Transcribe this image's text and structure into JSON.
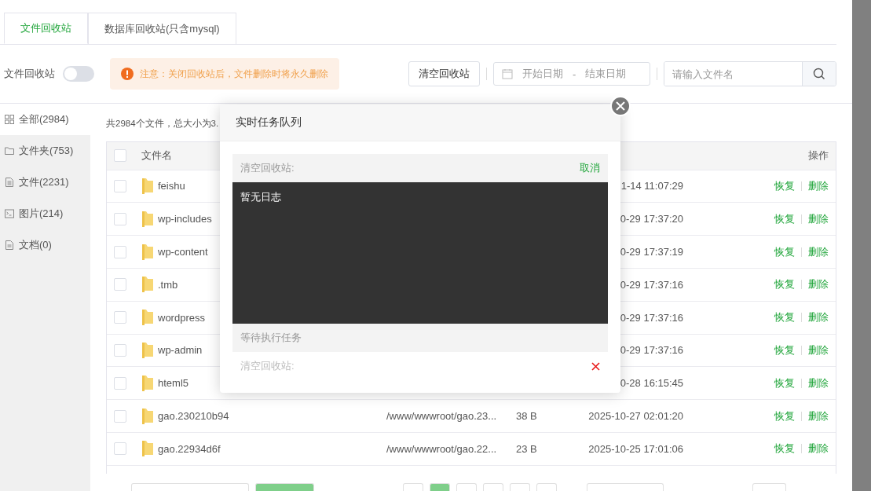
{
  "tabs": [
    {
      "label": "文件回收站",
      "selected": true
    },
    {
      "label": "数据库回收站(只含mysql)",
      "selected": false
    }
  ],
  "recycle_toggle": {
    "label": "文件回收站",
    "on": false
  },
  "notice": {
    "text": "注意：关闭回收站后，文件删除时将永久删除"
  },
  "toolbar": {
    "clear_button": "清空回收站",
    "date_range": {
      "start_placeholder": "开始日期",
      "separator": "-",
      "end_placeholder": "结束日期"
    },
    "search": {
      "placeholder": "请输入文件名"
    }
  },
  "sidebar": {
    "items": [
      {
        "kind": "all",
        "label": "全部(2984)",
        "selected": true
      },
      {
        "kind": "folder",
        "label": "文件夹(753)",
        "selected": false
      },
      {
        "kind": "file",
        "label": "文件(2231)",
        "selected": false
      },
      {
        "kind": "image",
        "label": "图片(214)",
        "selected": false
      },
      {
        "kind": "doc",
        "label": "文档(0)",
        "selected": false
      }
    ]
  },
  "summary": "共2984个文件，总大小为3.",
  "table": {
    "header": {
      "checked": false,
      "name": "文件名",
      "actions": "操作"
    },
    "rows": [
      {
        "checked": false,
        "name": "feishu",
        "time": "1-14 11:07:29",
        "actions": [
          "恢复",
          "删除"
        ]
      },
      {
        "checked": false,
        "name": "wp-includes",
        "time": "0-29 17:37:20",
        "actions": [
          "恢复",
          "删除"
        ]
      },
      {
        "checked": false,
        "name": "wp-content",
        "time": "0-29 17:37:19",
        "actions": [
          "恢复",
          "删除"
        ]
      },
      {
        "checked": false,
        "name": ".tmb",
        "time": "0-29 17:37:16",
        "actions": [
          "恢复",
          "删除"
        ]
      },
      {
        "checked": false,
        "name": "wordpress",
        "time": "0-29 17:37:16",
        "actions": [
          "恢复",
          "删除"
        ]
      },
      {
        "checked": false,
        "name": "wp-admin",
        "time": "0-29 17:37:16",
        "actions": [
          "恢复",
          "删除"
        ]
      },
      {
        "checked": false,
        "name": "hteml5",
        "time": "0-28 16:15:45",
        "actions": [
          "恢复",
          "删除"
        ]
      },
      {
        "checked": false,
        "name": "gao.230210b94",
        "path": "/www/wwwroot/gao.23...",
        "size": "38 B",
        "time": "2025-10-27 02:01:20",
        "actions": [
          "恢复",
          "删除"
        ]
      },
      {
        "checked": false,
        "name": "gao.22934d6f",
        "path": "/www/wwwroot/gao.22...",
        "size": "23 B",
        "time": "2025-10-25 17:01:06",
        "actions": [
          "恢复",
          "删除"
        ]
      }
    ]
  },
  "modal": {
    "title": "实时任务队列",
    "task": {
      "label": "清空回收站:",
      "cancel": "取消",
      "log": "暂无日志"
    },
    "waiting": {
      "title": "等待执行任务",
      "items": [
        {
          "label": "清空回收站:"
        }
      ]
    }
  }
}
